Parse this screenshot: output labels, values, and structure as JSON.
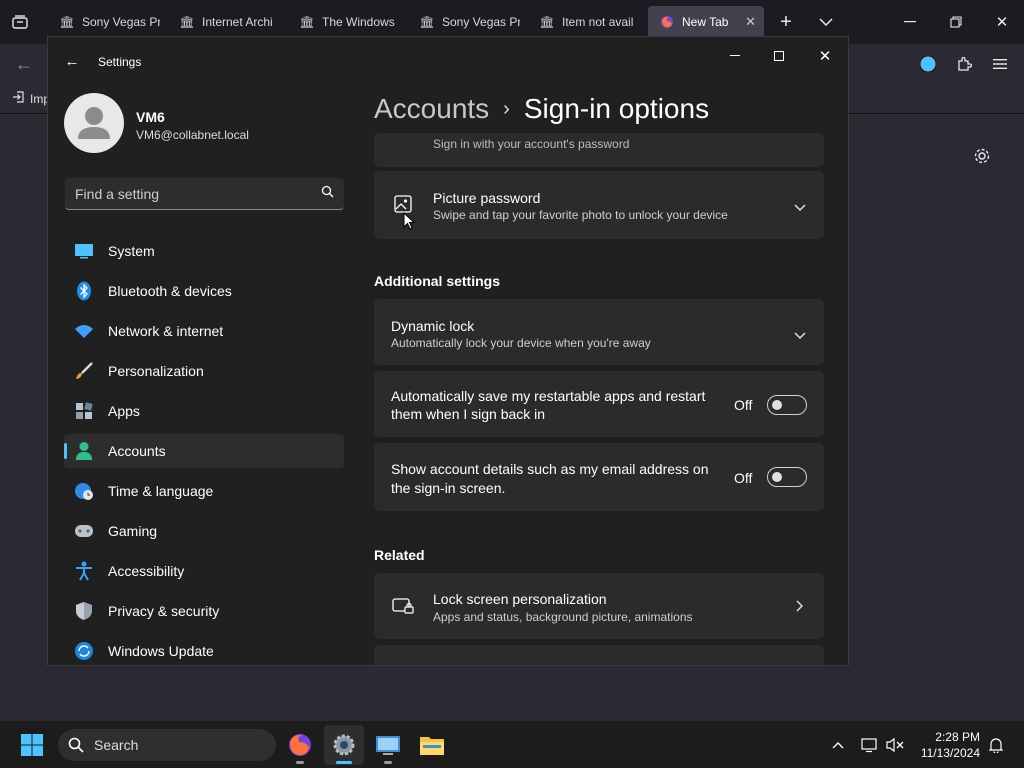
{
  "browser": {
    "tabs": [
      {
        "label": "Sony Vegas Pr",
        "icon": "archive-icon"
      },
      {
        "label": "Internet Archi",
        "icon": "archive-icon"
      },
      {
        "label": "The Windows",
        "icon": "archive-icon"
      },
      {
        "label": "Sony Vegas Pr",
        "icon": "archive-icon"
      },
      {
        "label": "Item not avail",
        "icon": "archive-icon"
      },
      {
        "label": "New Tab",
        "icon": "firefox-icon",
        "active": true
      }
    ],
    "bookmark_import": "Imp"
  },
  "settings": {
    "window_title": "Settings",
    "profile": {
      "name": "VM6",
      "email": "VM6@collabnet.local"
    },
    "search_placeholder": "Find a setting",
    "nav": [
      {
        "label": "System",
        "icon": "monitor-icon"
      },
      {
        "label": "Bluetooth & devices",
        "icon": "bluetooth-icon"
      },
      {
        "label": "Network & internet",
        "icon": "wifi-icon"
      },
      {
        "label": "Personalization",
        "icon": "brush-icon"
      },
      {
        "label": "Apps",
        "icon": "apps-icon"
      },
      {
        "label": "Accounts",
        "icon": "person-icon",
        "selected": true
      },
      {
        "label": "Time & language",
        "icon": "globe-clock-icon"
      },
      {
        "label": "Gaming",
        "icon": "gamepad-icon"
      },
      {
        "label": "Accessibility",
        "icon": "accessibility-icon"
      },
      {
        "label": "Privacy & security",
        "icon": "shield-icon"
      },
      {
        "label": "Windows Update",
        "icon": "update-icon"
      }
    ],
    "breadcrumb": {
      "parent": "Accounts",
      "current": "Sign-in options"
    },
    "partial_card_sub": "Sign in with your account's password",
    "picture_password": {
      "title": "Picture password",
      "subtitle": "Swipe and tap your favorite photo to unlock your device"
    },
    "additional_heading": "Additional settings",
    "dynamic_lock": {
      "title": "Dynamic lock",
      "subtitle": "Automatically lock your device when you're away"
    },
    "restart_apps": {
      "line1": "Automatically save my restartable apps and restart",
      "line2": "them when I sign back in",
      "state": "Off"
    },
    "account_details": {
      "line1": "Show account details such as my email address on",
      "line2": "the sign-in screen.",
      "state": "Off"
    },
    "related_heading": "Related",
    "lock_screen": {
      "title": "Lock screen personalization",
      "subtitle": "Apps and status, background picture, animations"
    }
  },
  "taskbar": {
    "search_label": "Search",
    "time": "2:28 PM",
    "date": "11/13/2024"
  },
  "colors": {
    "accent": "#4cc2ff",
    "card": "#2b2b2b",
    "window": "#202020"
  }
}
